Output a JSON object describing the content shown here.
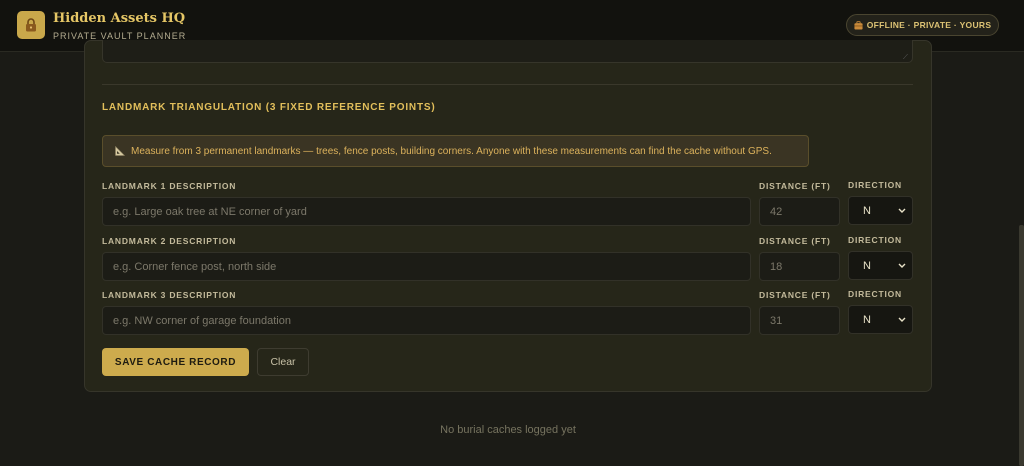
{
  "header": {
    "logo_icon": "lock-icon",
    "title": "Hidden Assets HQ",
    "subtitle": "PRIVATE VAULT PLANNER",
    "status_icon": "briefcase-icon",
    "status": "OFFLINE · PRIVATE · YOURS"
  },
  "section": {
    "title": "LANDMARK TRIANGULATION (3 FIXED REFERENCE POINTS)",
    "notice_icon": "ruler-icon",
    "notice": "Measure from 3 permanent landmarks — trees, fence posts, building corners. Anyone with these measurements can find the cache without GPS."
  },
  "landmarks": [
    {
      "label": "LANDMARK 1 DESCRIPTION",
      "placeholder": "e.g. Large oak tree at NE corner of yard",
      "distance_label": "DISTANCE (FT)",
      "distance_placeholder": "42",
      "direction_label": "DIRECTION",
      "direction": "N"
    },
    {
      "label": "LANDMARK 2 DESCRIPTION",
      "placeholder": "e.g. Corner fence post, north side",
      "distance_label": "DISTANCE (FT)",
      "distance_placeholder": "18",
      "direction_label": "DIRECTION",
      "direction": "N"
    },
    {
      "label": "LANDMARK 3 DESCRIPTION",
      "placeholder": "e.g. NW corner of garage foundation",
      "distance_label": "DISTANCE (FT)",
      "distance_placeholder": "31",
      "direction_label": "DIRECTION",
      "direction": "N"
    }
  ],
  "actions": {
    "save": "SAVE CACHE RECORD",
    "clear": "Clear"
  },
  "empty_state": "No burial caches logged yet",
  "colors": {
    "accent": "#cdab4d",
    "background": "#1b1b16",
    "card": "#262619"
  }
}
